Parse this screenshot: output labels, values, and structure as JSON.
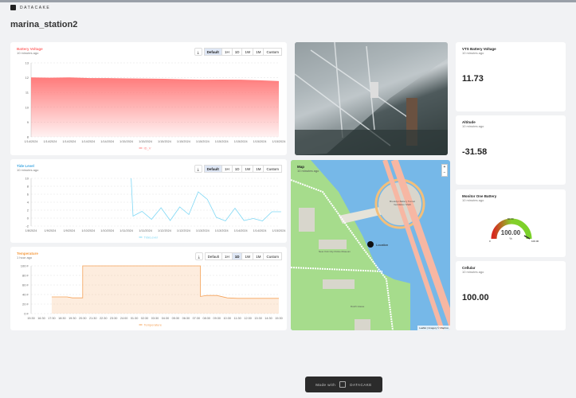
{
  "brand": "DATACAKE",
  "page_title": "marina_station2",
  "range_buttons": [
    "Default",
    "1H",
    "1D",
    "1W",
    "1M",
    "Custom"
  ],
  "widgets": {
    "battery": {
      "title": "Battery Voltage",
      "subtitle": "10 minutes ago",
      "legend": "ID_V",
      "color": "#ff7b7b",
      "active": "Default"
    },
    "tide": {
      "title": "Tide Level",
      "subtitle": "10 minutes ago",
      "legend": "TideLevel",
      "color": "#7fd8f5",
      "active": "Default"
    },
    "temp": {
      "title": "Temperature",
      "subtitle": "1 hour ago",
      "legend": "Temperature",
      "color": "#f5a35a",
      "active": "1D"
    },
    "map": {
      "title": "Map",
      "subtitle": "10 minutes ago",
      "marker": "Location",
      "attribution": "Leaflet | Imagery © Mapbox",
      "labels": [
        "Battery Tunnel",
        "Brooklyn Battery Tunnel Ventilation Shaft",
        "MAST Center",
        "New York City Police Museum",
        "Governors Island Ferry",
        "Pier A2",
        "Dutch House",
        "Admiral's House"
      ]
    },
    "vts": {
      "title": "VTS Battery Voltage",
      "subtitle": "10 minutes ago",
      "value": "11.73"
    },
    "altitude": {
      "title": "Altitude",
      "subtitle": "10 minutes ago",
      "value": "-31.58"
    },
    "monitor": {
      "title": "Monitor One Battery",
      "subtitle": "10 minutes ago",
      "value": "100.00",
      "unit": "%",
      "min": "0",
      "mid": "50.00",
      "max": "100.00",
      "level": 100
    },
    "cellular": {
      "title": "Cellular",
      "subtitle": "10 minutes ago",
      "value": "100.00"
    }
  },
  "footer": {
    "made_with": "Made with",
    "brand": "DATACAKE"
  },
  "chart_data": [
    {
      "type": "area",
      "title": "Battery Voltage",
      "ylim": [
        8,
        13
      ],
      "yticks": [
        8,
        9,
        10,
        11,
        12,
        13
      ],
      "categories": [
        "1/14/2024",
        "1/14/2024",
        "1/14/2024",
        "1/14/2024",
        "1/14/2024",
        "1/15/2024",
        "1/15/2024",
        "1/15/2024",
        "1/15/2024",
        "1/15/2024",
        "1/15/2024",
        "1/15/2024",
        "1/15/2024",
        "1/15/2024"
      ],
      "series": [
        {
          "name": "ID_V",
          "values": [
            12.0,
            11.98,
            12.0,
            11.96,
            11.95,
            11.93,
            11.92,
            11.9,
            11.87,
            11.84,
            11.85,
            11.84,
            11.8,
            11.75
          ]
        }
      ]
    },
    {
      "type": "line",
      "title": "Tide Level",
      "ylim": [
        -2,
        10
      ],
      "yticks": [
        -2,
        0,
        2,
        4,
        6,
        8,
        10
      ],
      "categories": [
        "1/8/2024",
        "1/9/2024",
        "1/9/2024",
        "1/10/2024",
        "1/10/2024",
        "1/11/2024",
        "1/11/2024",
        "1/12/2024",
        "1/12/2024",
        "1/13/2024",
        "1/13/2024",
        "1/14/2024",
        "1/14/2024",
        "1/15/2024"
      ],
      "series": [
        {
          "name": "TideLevel",
          "x": [
            5.25,
            5.35,
            5.82,
            6.32,
            6.82,
            7.3,
            7.8,
            8.28,
            8.77,
            9.25,
            9.72,
            10.2,
            10.7,
            11.17,
            11.66,
            12.14,
            12.64,
            13.12
          ],
          "values": [
            10,
            0.5,
            1.7,
            -0.3,
            2.6,
            -0.6,
            2.8,
            0.9,
            6.6,
            4.7,
            0.2,
            -0.7,
            2.5,
            -0.6,
            -0.1,
            -0.7,
            1.6,
            1.6
          ]
        }
      ]
    },
    {
      "type": "area",
      "title": "Temperature",
      "ylim": [
        0,
        100
      ],
      "yticks": [
        "0 F",
        "20 F",
        "40 F",
        "60 F",
        "80 F",
        "100 F"
      ],
      "categories": [
        "15:30",
        "16:30",
        "17:30",
        "18:30",
        "19:30",
        "20:30",
        "21:30",
        "22:30",
        "23:30",
        "24:00",
        "01:30",
        "02:30",
        "03:30",
        "04:30",
        "05:30",
        "06:30",
        "07:30",
        "08:30",
        "09:30",
        "10:30",
        "11:30",
        "12:30",
        "13:30",
        "14:30",
        "15:30"
      ],
      "series": [
        {
          "name": "Temperature",
          "x": [
            2,
            3.5,
            4,
            5,
            5,
            16.4,
            16.4,
            17,
            18,
            19,
            20,
            24
          ],
          "values": [
            35,
            35,
            33,
            33,
            100,
            100,
            36,
            38,
            38,
            33,
            32,
            32
          ]
        }
      ]
    }
  ]
}
